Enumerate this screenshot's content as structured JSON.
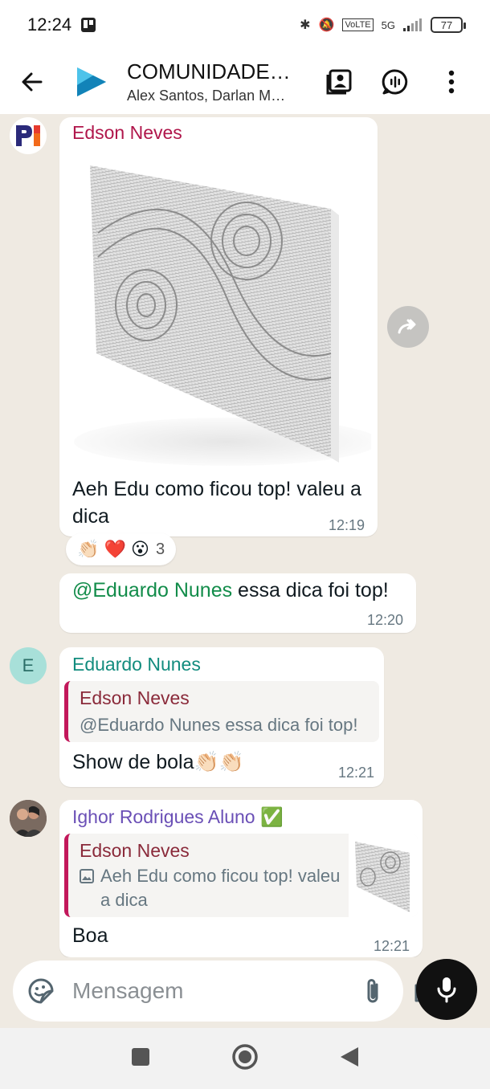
{
  "status_bar": {
    "time": "12:24",
    "network": "5G",
    "battery": "77"
  },
  "header": {
    "title": "COMUNIDADE…",
    "subtitle": "Alex Santos, Darlan M…"
  },
  "messages": {
    "m1": {
      "sender": "Edson Neves",
      "sender_color": "#b0164b",
      "text": "Aeh Edu como ficou top! valeu a dica",
      "time": "12:19",
      "reactions": {
        "emojis": "👏🏻 ❤️ 😮",
        "count": "3"
      }
    },
    "m2": {
      "mention": "@Eduardo Nunes",
      "text": " essa dica foi top!",
      "time": "12:20"
    },
    "m3": {
      "avatar_letter": "E",
      "sender": "Eduardo Nunes",
      "sender_color": "#128c7e",
      "quote_name": "Edson Neves",
      "quote_text": "@Eduardo Nunes essa dica foi top!",
      "text": "Show de bola👏🏻👏🏻",
      "time": "12:21"
    },
    "m4": {
      "sender": "Ighor Rodrigues Aluno ✅",
      "sender_color": "#6a4fb6",
      "quote_name": "Edson Neves",
      "quote_text": "Aeh Edu como ficou top! valeu a dica",
      "text": "Boa",
      "time": "12:21"
    }
  },
  "composer": {
    "placeholder": "Mensagem"
  }
}
